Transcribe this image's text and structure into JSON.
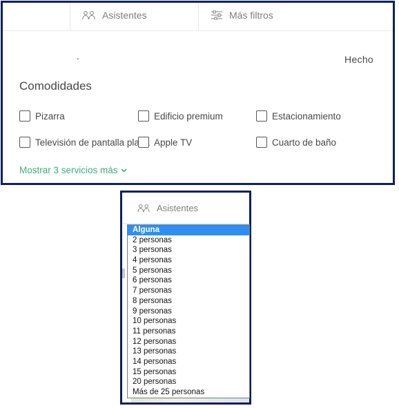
{
  "filter_bar": {
    "attendees_label": "Asistentes",
    "more_filters_label": "Más filtros"
  },
  "dot_text": ".",
  "done_label": "Hecho",
  "amenities_title": "Comodidades",
  "amenities": [
    {
      "label": "Pizarra",
      "checked": false
    },
    {
      "label": "Edificio premium",
      "checked": false
    },
    {
      "label": "Estacionamiento",
      "checked": false
    },
    {
      "label": "Televisión de pantalla plana",
      "checked": false
    },
    {
      "label": "Apple TV",
      "checked": false
    },
    {
      "label": "Cuarto de baño",
      "checked": false
    }
  ],
  "show_more_label": "Mostrar 3 servicios más",
  "attendees_dropdown": {
    "field_label": "Asistentes",
    "selected_index": 0,
    "options": [
      "Alguna",
      "2 personas",
      "3 personas",
      "4 personas",
      "5 personas",
      "6 personas",
      "7 personas",
      "8 personas",
      "9 personas",
      "10 personas",
      "11 personas",
      "12 personas",
      "13 personas",
      "14 personas",
      "15 personas",
      "20 personas",
      "Más de 25 personas"
    ]
  },
  "colors": {
    "frame_border": "#0e1f5b",
    "link_green": "#3fae7a",
    "selection_blue": "#2d8ff5"
  },
  "icons": [
    "people-icon",
    "sliders-icon",
    "chevron-down-icon"
  ]
}
